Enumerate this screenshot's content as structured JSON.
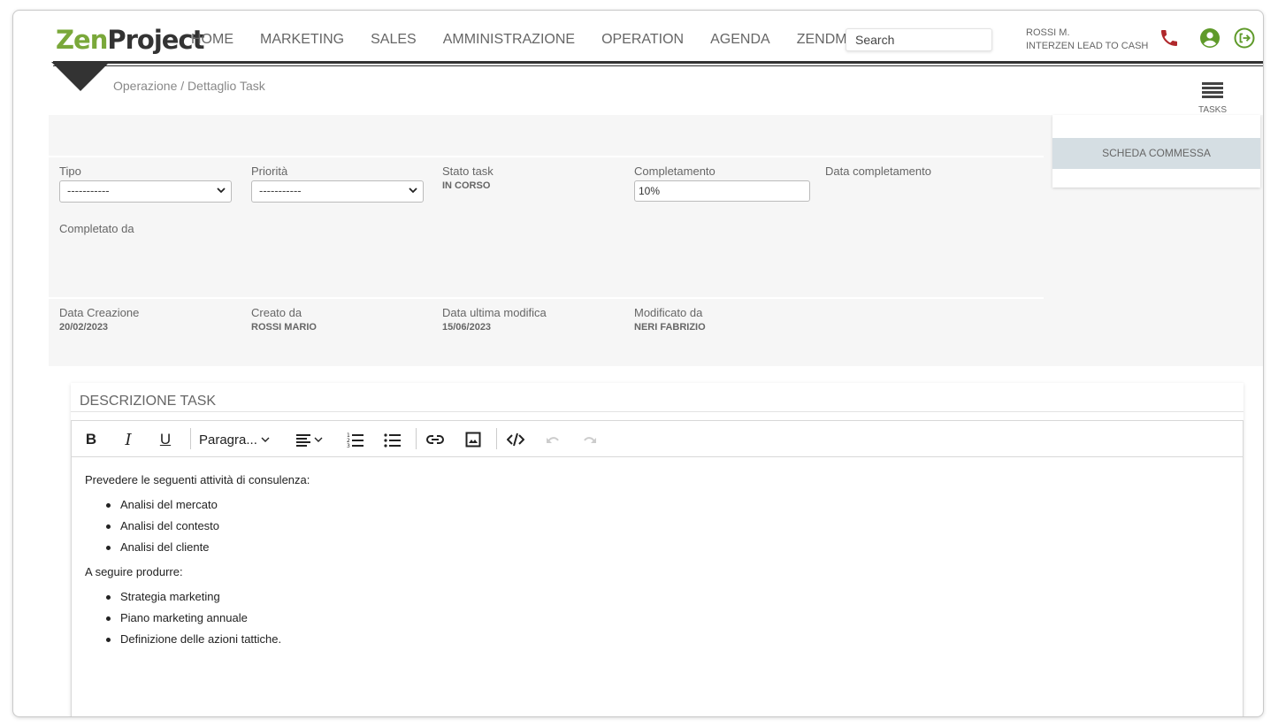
{
  "header": {
    "logo_part1": "Zen",
    "logo_part2": "Project",
    "nav": [
      "HOME",
      "MARKETING",
      "SALES",
      "AMMINISTRAZIONE",
      "OPERATION",
      "AGENDA",
      "ZENDMS"
    ],
    "search_placeholder": "Search",
    "user_name": "ROSSI M.",
    "user_company": "INTERZEN LEAD TO CASH",
    "icons": [
      "phone-icon",
      "user-icon",
      "logout-icon"
    ],
    "colors": {
      "logo_green": "#7aa83a",
      "phone": "#b0282c",
      "user": "#5f9a2a",
      "logout": "#5f9a2a"
    }
  },
  "breadcrumb": "Operazione / Dettaglio Task",
  "tasks_button": {
    "label": "TASKS",
    "icon": "list-icon"
  },
  "side_card": {
    "button_label": "SCHEDA COMMESSA"
  },
  "fields": {
    "tipo": {
      "label": "Tipo",
      "value": "-----------"
    },
    "priorita": {
      "label": "Priorità",
      "value": "-----------"
    },
    "stato": {
      "label": "Stato task",
      "value": "IN CORSO"
    },
    "completamento": {
      "label": "Completamento",
      "value": "10%"
    },
    "data_completamento": {
      "label": "Data completamento"
    },
    "completato_da": {
      "label": "Completato da"
    },
    "data_creazione": {
      "label": "Data Creazione",
      "value": "20/02/2023"
    },
    "creato_da": {
      "label": "Creato da",
      "value": "ROSSI MARIO"
    },
    "data_modifica": {
      "label": "Data ultima modifica",
      "value": "15/06/2023"
    },
    "modificato_da": {
      "label": "Modificato da",
      "value": "NERI FABRIZIO"
    }
  },
  "description": {
    "title": "DESCRIZIONE TASK",
    "toolbar": {
      "bold": "B",
      "italic": "I",
      "underline": "U",
      "paragraph": "Paragra...",
      "icons": [
        "align-icon",
        "ordered-list-icon",
        "bullet-list-icon",
        "link-icon",
        "image-icon",
        "code-icon",
        "undo-icon",
        "redo-icon"
      ]
    },
    "intro": "Prevedere le seguenti attività di consulenza:",
    "list1": [
      "Analisi del mercato",
      "Analisi del contesto",
      "Analisi del cliente"
    ],
    "middle": "A seguire produrre:",
    "list2": [
      "Strategia marketing",
      "Piano marketing annuale",
      "Definizione delle azioni tattiche."
    ]
  }
}
